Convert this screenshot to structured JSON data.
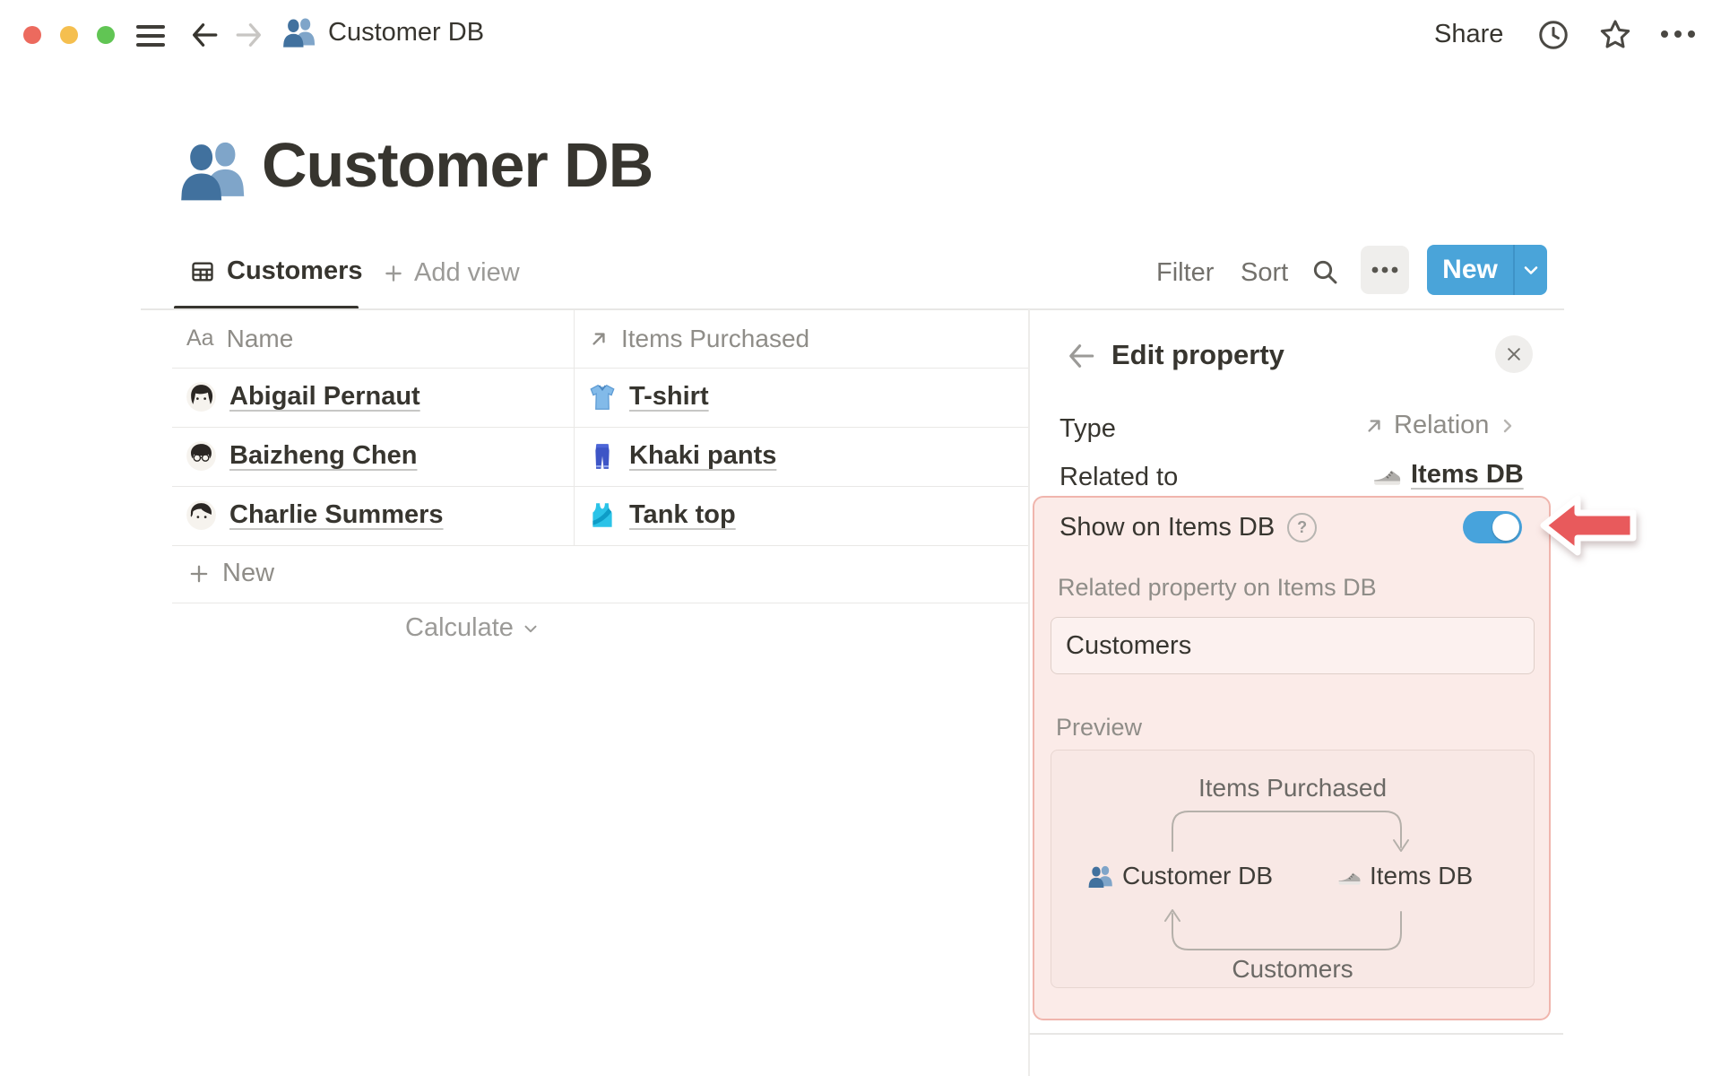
{
  "topbar": {
    "breadcrumb": "Customer DB",
    "share": "Share"
  },
  "page": {
    "icon": "people-icon",
    "title": "Customer DB"
  },
  "toolbar": {
    "tab": "Customers",
    "add_view": "Add view",
    "filter": "Filter",
    "sort": "Sort",
    "new": "New"
  },
  "table": {
    "columns": [
      {
        "label": "Name",
        "icon": "title-icon"
      },
      {
        "label": "Items Purchased",
        "icon": "relation-icon"
      }
    ],
    "rows": [
      {
        "name": "Abigail Pernaut",
        "item": "T-shirt",
        "item_icon": "tshirt-icon"
      },
      {
        "name": "Baizheng Chen",
        "item": "Khaki pants",
        "item_icon": "jeans-icon"
      },
      {
        "name": "Charlie Summers",
        "item": "Tank top",
        "item_icon": "tanktop-icon"
      }
    ],
    "new_row": "New",
    "calculate": "Calculate"
  },
  "panel": {
    "title": "Edit property",
    "type": {
      "label": "Type",
      "value": "Relation",
      "value_icon": "relation-icon"
    },
    "related_to": {
      "label": "Related to",
      "value": "Items DB",
      "value_icon": "sneaker-icon"
    },
    "show_on": {
      "label": "Show on Items DB",
      "enabled": true
    },
    "related_property": {
      "label": "Related property on Items DB",
      "value": "Customers"
    },
    "preview": {
      "label": "Preview",
      "top_relation": "Items Purchased",
      "left_db": "Customer DB",
      "left_db_icon": "people-icon",
      "right_db": "Items DB",
      "right_db_icon": "sneaker-icon",
      "bottom_relation": "Customers"
    }
  },
  "icons": {
    "title_glyph": "Aa",
    "help_glyph": "?"
  },
  "colors": {
    "accent_blue": "#4AA4D9",
    "toggle_on_blue": "#47A3DC",
    "highlight_bg": "#FBEBE8",
    "highlight_border": "#F0B5AD",
    "arrow_red": "#E85A5C",
    "text_primary": "#37352F",
    "text_secondary": "#8F8D88",
    "traffic_red": "#EC6A5E",
    "traffic_yellow": "#F5BF4F",
    "traffic_green": "#61C554"
  }
}
